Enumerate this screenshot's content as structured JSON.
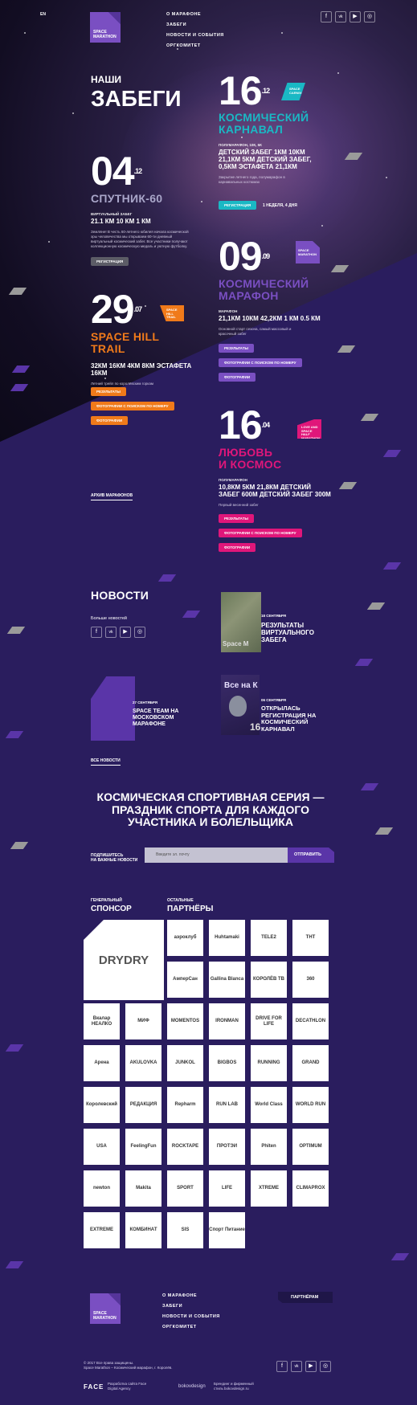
{
  "header": {
    "lang": "EN",
    "logo_text": "SPACE\nMARATHON",
    "nav": [
      "О МАРАФОНЕ",
      "ЗАБЕГИ",
      "НОВОСТИ И СОБЫТИЯ",
      "ОРГКОМИТЕТ"
    ],
    "social": [
      "f",
      "vk",
      "yt",
      "ig"
    ]
  },
  "races": {
    "title_line1": "НАШИ",
    "title_line2": "ЗАБЕГИ",
    "items": [
      {
        "day": "16",
        "month": ".12",
        "tag": "SPACE CARNIVAL",
        "name": "КОСМИЧЕСКИЙ\nКАРНАВАЛ",
        "type": "ПОЛУМАРАФОН, 10К, 5К",
        "dist": "ДЕТСКИЙ ЗАБЕГ 1КМ 10КМ 21,1КМ 5КМ ДЕТСКИЙ ЗАБЕГ, 0,5КМ ЭСТАФЕТА 21,1КМ",
        "desc": "Закрытие летнего года, полумарафон в карнавальных костюмах",
        "button": "РЕГИСТРАЦИЯ",
        "countdown": "1 НЕДЕЛЯ, 4 ДНЯ"
      },
      {
        "day": "04",
        "month": ".12",
        "name": "СПУТНИК-60",
        "type": "ВИРТУАЛЬНЫЙ ЗАБЕГ",
        "dist": "21.1 КМ 10 КМ 1 КМ",
        "desc": "Земляне! В честь 60-летнего юбилея начала космической эры человечества мы открываем 60-ти дневный виртуальный космический забег. Все участники получают коллекционную космическую медаль и уютную футболку.",
        "button": "РЕГИСТРАЦИЯ"
      },
      {
        "day": "09",
        "month": ".09",
        "tag": "SPACE MARATHON",
        "name": "КОСМИЧЕСКИЙ\nМАРАФОН",
        "type": "МАРАФОН",
        "dist": "21,1КМ 10КМ 42,2КМ 1 КМ 0.5 КМ",
        "desc": "Основной старт сезона, самый массовый и красочный забег",
        "buttons": [
          "РЕЗУЛЬТАТЫ",
          "ФОТОГРАФИИ С ПОИСКОМ ПО НОМЕРУ",
          "ФОТОГРАФИИ"
        ]
      },
      {
        "day": "29",
        "month": ".07",
        "tag": "SPACE HILL TRAIL",
        "name": "SPACE HILL\nTRAIL",
        "dist": "32КМ 16КМ 4КМ 8КМ ЭСТАФЕТА 16КМ",
        "desc": "Летний трейл по королёвским горкам",
        "buttons": [
          "РЕЗУЛЬТАТЫ",
          "ФОТОГРАФИИ С ПОИСКОМ ПО НОМЕРУ",
          "ФОТОГРАФИИ"
        ]
      },
      {
        "day": "16",
        "month": ".04",
        "tag": "LOVE AND SPACE HALF MARATHON",
        "name": "ЛЮБОВЬ\nИ КОСМОС",
        "type": "ПОЛУМАРАФОН",
        "dist": "10,8КМ 5КМ 21,8КМ ДЕТСКИЙ ЗАБЕГ 600М ДЕТСКИЙ ЗАБЕГ 300М",
        "desc": "Первый весенний забег",
        "buttons": [
          "РЕЗУЛЬТАТЫ",
          "ФОТОГРАФИИ С ПОИСКОМ ПО НОМЕРУ",
          "ФОТОГРАФИИ"
        ]
      }
    ],
    "archive": "АРХИВ МАРАФОНОВ"
  },
  "news": {
    "title": "НОВОСТИ",
    "more": "Больше новостей",
    "items": [
      {
        "date": "18 СЕНТЯБРЯ",
        "title": "РЕЗУЛЬТАТЫ ВИРТУАЛЬНОГО ЗАБЕГА",
        "img": "Space M"
      },
      {
        "date": "27 СЕНТЯБРЯ",
        "title": "SPACE TEAM НА МОСКОВСКОМ МАРАФОНЕ"
      },
      {
        "date": "06 СЕНТЯБРЯ",
        "title": "ОТКРЫЛАСЬ РЕГИСТРАЦИЯ НА КОСМИЧЕСКИЙ КАРНАВАЛ",
        "img": "Все на К",
        "img2": "16"
      }
    ],
    "all": "ВСЕ НОВОСТИ"
  },
  "promo": {
    "headline": "КОСМИЧЕСКАЯ СПОРТИВНАЯ СЕРИЯ — ПРАЗДНИК СПОРТА ДЛЯ КАЖДОГО УЧАСТНИКА И БОЛЕЛЬЩИКА",
    "subscribe_label": "ПОДПИШИТЕСЬ\nНА ВАЖНЫЕ НОВОСТИ",
    "email_placeholder": "Введите эл. почту",
    "submit": "ОТПРАВИТЬ"
  },
  "sponsors": {
    "general_label": "ГЕНЕРАЛЬНЫЙ",
    "general_title": "СПОНСОР",
    "general_logo": "DRYDRY",
    "others_label": "ОСТАЛЬНЫЕ",
    "others_title": "ПАРТНЁРЫ",
    "logos": [
      "аэроклуб",
      "Huhtamaki",
      "TELE2",
      "ТНТ",
      "АмперСан",
      "Gallina Blanca",
      "КОРОЛЁВ ТВ",
      "360",
      "Вкалар НЕАЛКО",
      "МИФ",
      "MOMENTOS",
      "IRONMAN",
      "DRIVE FOR LIFE",
      "DECATHLON",
      "Арена",
      "AKULOVKA",
      "JUNKOL",
      "BIGBOS",
      "RUNNING",
      "GRAND",
      "Королевский",
      "РЕДАКЦИЯ",
      "Repharm",
      "RUN LAB",
      "World Class",
      "WORLD RUN",
      "USA",
      "FeelingFun",
      "ROCKTAPE",
      "ПРОТЭИ",
      "Phiten",
      "OPTIMUM",
      "newton",
      "Makita",
      "SPORT",
      "LIFE",
      "XTREME",
      "CLIMAPROX",
      "EXTREME",
      "КОМБИНАТ",
      "SIS",
      "Спорт Питание"
    ]
  },
  "footer": {
    "logo_text": "SPACE\nMARATHON",
    "nav": [
      "О МАРАФОНЕ",
      "ЗАБЕГИ",
      "НОВОСТИ И СОБЫТИЯ",
      "ОРГКОМИТЕТ"
    ],
    "partners_button": "ПАРТНЁРАМ",
    "copyright": "© 2017 Все права защищены.\nSpace Marathon – Космический марафон, г. Королёв.",
    "dev1_logo": "FACE",
    "dev1_text": "Разработка сайта Face\nDigital Agency",
    "dev2_logo": "bokovdesign",
    "dev2_text": "Брендинг и фирменный\nстиль bokovdesign.ru"
  },
  "colors": {
    "bg": "#2a1d5e",
    "teal": "#1ab8c4",
    "purple": "#7a4fc2",
    "orange": "#f07a1a",
    "pink": "#e0167a",
    "violet": "#5a35a8"
  }
}
